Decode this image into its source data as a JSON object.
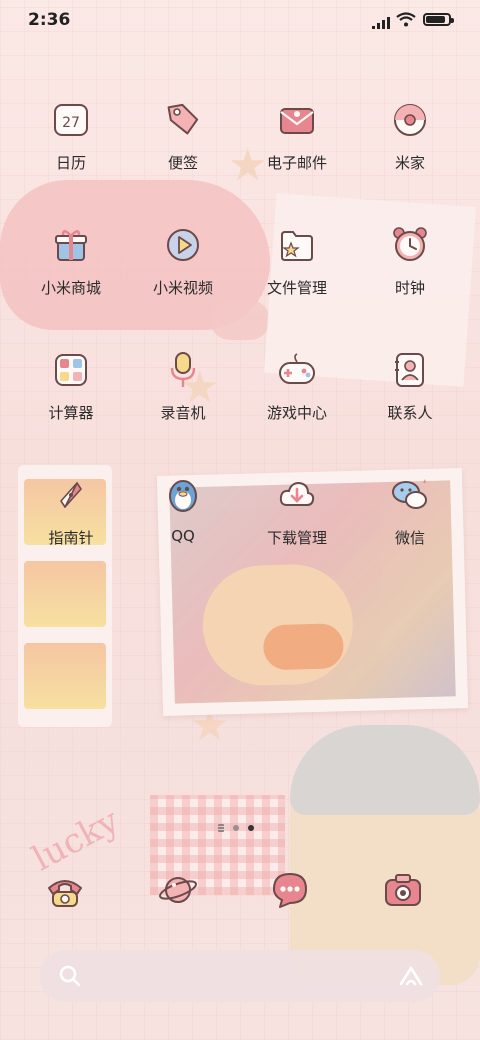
{
  "status_bar": {
    "time": "2:36",
    "battery_level": 0.85
  },
  "rows": [
    [
      {
        "label": "日历",
        "icon": "calendar-icon",
        "number": "27"
      },
      {
        "label": "便签",
        "icon": "tag-icon"
      },
      {
        "label": "电子邮件",
        "icon": "email-icon"
      },
      {
        "label": "米家",
        "icon": "home-device-icon"
      }
    ],
    [
      {
        "label": "小米商城",
        "icon": "gift-icon"
      },
      {
        "label": "小米视频",
        "icon": "play-icon"
      },
      {
        "label": "文件管理",
        "icon": "folder-icon"
      },
      {
        "label": "时钟",
        "icon": "clock-icon"
      }
    ],
    [
      {
        "label": "计算器",
        "icon": "calculator-icon"
      },
      {
        "label": "录音机",
        "icon": "microphone-icon"
      },
      {
        "label": "游戏中心",
        "icon": "gamepad-icon"
      },
      {
        "label": "联系人",
        "icon": "contacts-icon"
      }
    ],
    [
      {
        "label": "指南针",
        "icon": "compass-icon"
      },
      {
        "label": "QQ",
        "icon": "qq-penguin-icon"
      },
      {
        "label": "下载管理",
        "icon": "download-icon"
      },
      {
        "label": "微信",
        "icon": "wechat-icon"
      }
    ]
  ],
  "wallpaper_text": "lucky",
  "page_indicator": {
    "pages": 2,
    "active": 2
  },
  "dock": [
    {
      "icon": "phone-icon"
    },
    {
      "icon": "browser-planet-icon"
    },
    {
      "icon": "messages-icon"
    },
    {
      "icon": "camera-icon"
    }
  ],
  "colors": {
    "accent": "#e8868f",
    "outline": "#6b4a4a",
    "label_text": "#2b2b2b"
  }
}
